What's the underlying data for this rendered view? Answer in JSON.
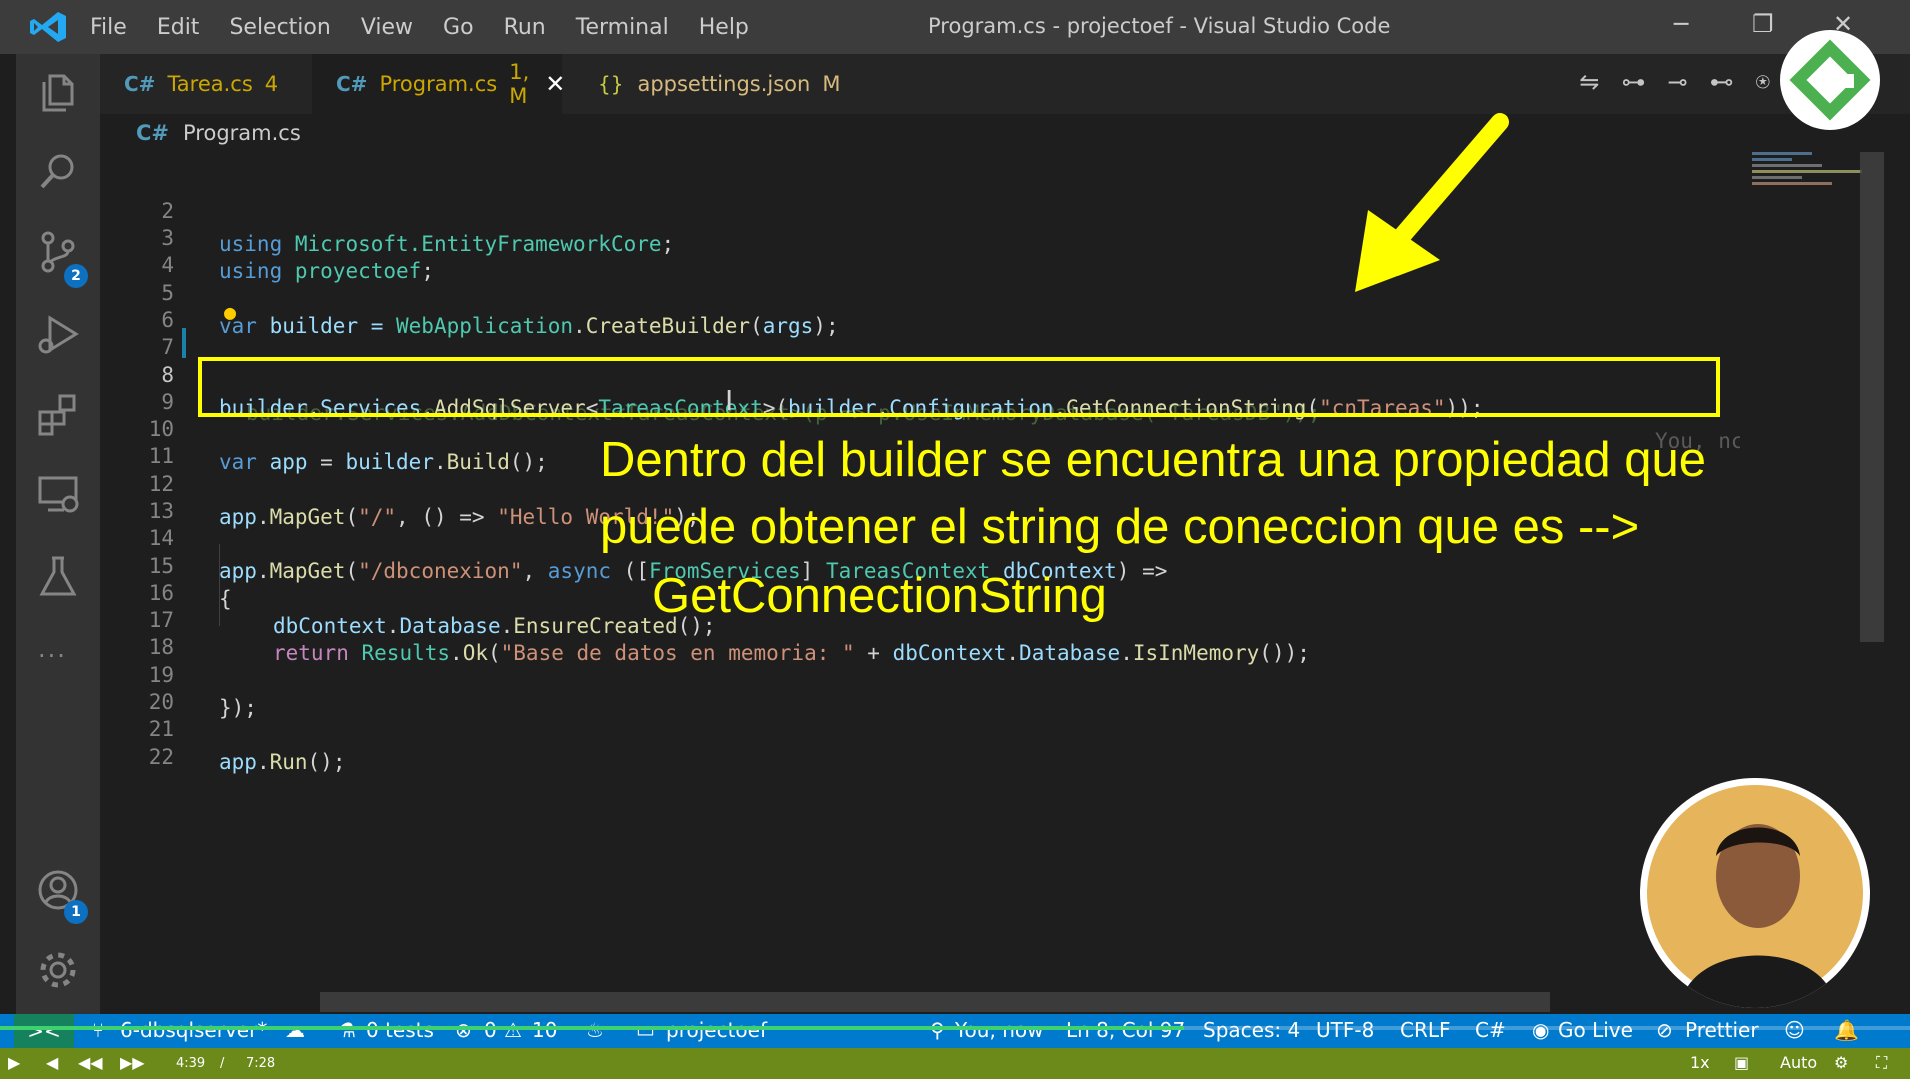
{
  "window": {
    "title": "Program.cs - projectoef - Visual Studio Code",
    "menu": [
      "File",
      "Edit",
      "Selection",
      "View",
      "Go",
      "Run",
      "Terminal",
      "Help"
    ],
    "controls": {
      "minimize": "─",
      "maximize": "❐",
      "close": "✕"
    }
  },
  "activity_bar": {
    "items": [
      "explorer-icon",
      "search-icon",
      "source-control-icon",
      "run-debug-icon",
      "extensions-icon",
      "remote-explorer-icon",
      "testing-icon",
      "more-icon",
      "accounts-icon",
      "settings-gear-icon"
    ],
    "source_control_badge": "2",
    "accounts_badge": "1",
    "more": "···"
  },
  "tabs": [
    {
      "icon": "C#",
      "name": "Tarea.cs",
      "status": "4",
      "color": "#cca700"
    },
    {
      "icon": "C#",
      "name": "Program.cs",
      "status": "1, M",
      "color": "#cca700",
      "active": true,
      "close": "✕"
    },
    {
      "icon": "{}",
      "name": "appsettings.json",
      "status": "M",
      "color": "#d7ba7d"
    }
  ],
  "breadcrumb": {
    "icon": "C#",
    "file": "Program.cs"
  },
  "editor": {
    "line_numbers": [
      "2",
      "3",
      "4",
      "5",
      "6",
      "7",
      "8",
      "9",
      "10",
      "11",
      "12",
      "13",
      "14",
      "15",
      "16",
      "17",
      "18",
      "19",
      "20",
      "21",
      "22"
    ],
    "current_line": "8",
    "blame": "You, nc",
    "lines": {
      "l2": [
        "using",
        " ",
        "Microsoft.EntityFrameworkCore",
        ";"
      ],
      "l3": [
        "using",
        " ",
        "proyectoef",
        ";"
      ],
      "l5": [
        "var",
        " builder = ",
        "WebApplication",
        ".",
        "CreateBuilder",
        "(",
        "args",
        ");"
      ],
      "l7": [
        "builder.Services.AddDbContext<TareasContext>(p => p.UseInMemoryDatabase(\"TareasDB\"));"
      ],
      "l8": [
        "builder",
        ".",
        "Services",
        ".",
        "AddSqlServer",
        "<",
        "TareasContext",
        ">(",
        "builder",
        ".",
        "Configuration",
        ".",
        "GetConnectionString",
        "(",
        "\"cnTareas\"",
        "));"
      ],
      "l10": [
        "var",
        " ",
        "app",
        " = ",
        "builder",
        ".",
        "Build",
        "();"
      ],
      "l12": [
        "app",
        ".",
        "MapGet",
        "(",
        "\"/\"",
        ", () => ",
        "\"Hello World!\"",
        ");"
      ],
      "l14": [
        "app",
        ".",
        "MapGet",
        "(",
        "\"/dbconexion\"",
        ", ",
        "async",
        " ([",
        "FromServices",
        "] ",
        "TareasContext",
        " ",
        "dbContext",
        ") =>"
      ],
      "l15": [
        "{"
      ],
      "l16": [
        "dbContext",
        ".",
        "Database",
        ".",
        "EnsureCreated",
        "();"
      ],
      "l17": [
        "return",
        " ",
        "Results",
        ".",
        "Ok",
        "(",
        "\"Base de datos en memoria: \"",
        " + ",
        "dbContext",
        ".",
        "Database",
        ".",
        "IsInMemory",
        "());"
      ],
      "l19": [
        "});"
      ],
      "l21": [
        "app",
        ".",
        "Run",
        "();"
      ]
    }
  },
  "annotation": {
    "line1": "Dentro del builder se encuentra una propiedad que",
    "line2": "puede obtener el string de coneccion que es -->",
    "line3": "GetConnectionString"
  },
  "status_bar": {
    "remote": "><",
    "branch": "6-dbsqlserver*",
    "tests": "0 tests",
    "errors": "0",
    "warnings": "10",
    "project": "projectoef",
    "blame": "You, now",
    "position": "Ln 8, Col 97",
    "spaces": "Spaces: 4",
    "encoding": "UTF-8",
    "eol": "CRLF",
    "language": "C#",
    "go_live": "Go Live",
    "prettier": "Prettier"
  },
  "player": {
    "current_time": "4:39",
    "separator": "/",
    "duration": "7:28",
    "progress": 0.62,
    "speed": "1x",
    "quality": "Auto"
  },
  "colors": {
    "accent": "#007acc",
    "highlight": "#ffff00",
    "player": "#6b8a1a"
  }
}
